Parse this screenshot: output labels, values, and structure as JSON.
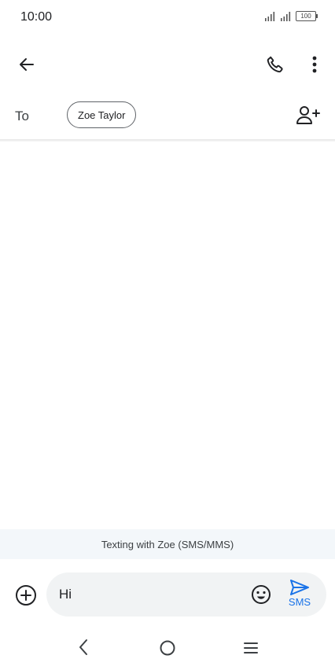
{
  "status_bar": {
    "time": "10:00",
    "battery": "100"
  },
  "recipient": {
    "to_label": "To",
    "chip_name": "Zoe Taylor"
  },
  "banner": {
    "text": "Texting with Zoe (SMS/MMS)"
  },
  "compose": {
    "message_value": "Hi",
    "send_label": "SMS"
  },
  "colors": {
    "accent": "#1a73e8",
    "banner_bg": "#f3f7fa",
    "compose_bg": "#f1f3f4"
  },
  "icons": {
    "back": "arrow-left-icon",
    "call": "phone-icon",
    "menu": "more-vert-icon",
    "add_contact": "person-add-icon",
    "attach": "plus-circle-icon",
    "emoji": "emoji-icon",
    "send": "send-icon",
    "nav_back": "chevron-left-icon",
    "nav_home": "circle-home-icon",
    "nav_menu": "hamburger-icon"
  }
}
